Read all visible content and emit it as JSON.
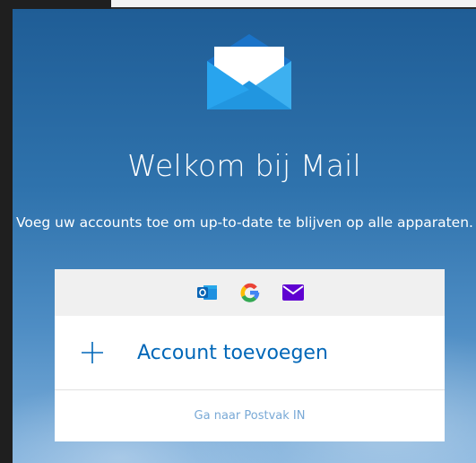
{
  "welcome": {
    "title": "Welkom bij Mail",
    "subtitle": "Voeg uw accounts toe om up-to-date te blijven op alle apparaten."
  },
  "providers": [
    {
      "icon": "outlook-icon"
    },
    {
      "icon": "google-icon"
    },
    {
      "icon": "yahoo-mail-icon"
    }
  ],
  "actions": {
    "add_account_label": "Account toevoegen",
    "go_to_inbox_label": "Ga naar Postvak IN"
  },
  "colors": {
    "link_blue": "#0067b8",
    "inbox_link": "#79a9d6",
    "background_top": "#1f5d96",
    "background_bottom": "#7fb0dc"
  }
}
